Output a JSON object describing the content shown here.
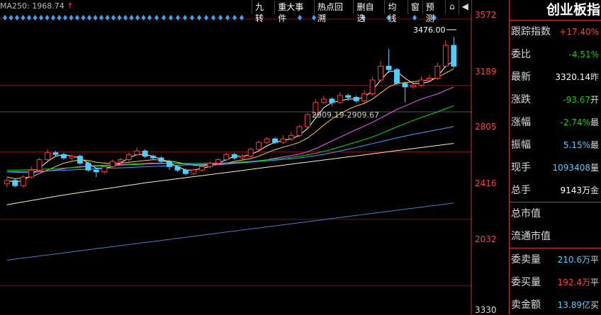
{
  "legend": {
    "ma250_label": "MA250: 1968.74",
    "arrow": "↑"
  },
  "toolbar": {
    "items": [
      "九转",
      "重大事件",
      "热点回溯",
      "删自选",
      "均线",
      "窗",
      "预测"
    ],
    "lock_icon": "lock-icon",
    "back_icon": "back-arrow-icon"
  },
  "price_axis": {
    "labels": [
      "3572",
      "3189",
      "2805",
      "2416",
      "2032",
      "3330"
    ]
  },
  "annotations": {
    "peak_label": "3476.00",
    "level_label": "2909.19-2909.67"
  },
  "panel": {
    "title": "创业板指",
    "rows": [
      {
        "label": "跟踪指数",
        "value": "+17.40%",
        "color": "red",
        "suffix": ""
      },
      {
        "label": "委比",
        "value": "-4.51%",
        "color": "green",
        "suffix": ""
      },
      {
        "label": "最新",
        "value": "3320.14",
        "color": "white",
        "suffix": "昨"
      },
      {
        "label": "涨跌",
        "value": "-93.67",
        "color": "green",
        "suffix": "开"
      },
      {
        "label": "涨幅",
        "value": "-2.74%",
        "color": "green",
        "suffix": "最"
      },
      {
        "label": "振幅",
        "value": "5.15%",
        "color": "cyan",
        "suffix": "最"
      },
      {
        "label": "现手",
        "value": "1093408",
        "color": "cyan",
        "suffix": "量"
      },
      {
        "label": "总手",
        "value": "9143万",
        "color": "white",
        "suffix": "金"
      },
      {
        "label": "总市值",
        "value": "",
        "color": "white",
        "suffix": ""
      },
      {
        "label": "流通市值",
        "value": "",
        "color": "white",
        "suffix": ""
      },
      {
        "label": "委卖量",
        "value": "210.6万",
        "color": "cyan",
        "suffix": "平"
      },
      {
        "label": "委买量",
        "value": "192.4万",
        "color": "red",
        "suffix": "平"
      },
      {
        "label": "卖金额",
        "value": "13.89亿",
        "color": "cyan",
        "suffix": "买"
      }
    ]
  },
  "chart_data": {
    "type": "candlestick",
    "y_ticks": [
      3572,
      3189,
      2805,
      2416,
      2032
    ],
    "ylim": [
      1900,
      3600
    ],
    "candles": [
      [
        2620,
        2640,
        2600,
        2655
      ],
      [
        2640,
        2610,
        2600,
        2650
      ],
      [
        2610,
        2660,
        2600,
        2670
      ],
      [
        2660,
        2700,
        2650,
        2720
      ],
      [
        2700,
        2760,
        2690,
        2770
      ],
      [
        2760,
        2800,
        2740,
        2820
      ],
      [
        2800,
        2790,
        2780,
        2810
      ],
      [
        2790,
        2770,
        2760,
        2800
      ],
      [
        2770,
        2780,
        2750,
        2790
      ],
      [
        2780,
        2740,
        2730,
        2790
      ],
      [
        2740,
        2700,
        2690,
        2750
      ],
      [
        2700,
        2690,
        2660,
        2710
      ],
      [
        2690,
        2720,
        2680,
        2730
      ],
      [
        2720,
        2750,
        2710,
        2760
      ],
      [
        2750,
        2760,
        2730,
        2770
      ],
      [
        2760,
        2790,
        2750,
        2800
      ],
      [
        2790,
        2810,
        2780,
        2830
      ],
      [
        2810,
        2780,
        2770,
        2820
      ],
      [
        2780,
        2770,
        2760,
        2790
      ],
      [
        2770,
        2750,
        2740,
        2780
      ],
      [
        2750,
        2720,
        2700,
        2760
      ],
      [
        2720,
        2700,
        2690,
        2730
      ],
      [
        2700,
        2680,
        2670,
        2710
      ],
      [
        2680,
        2700,
        2670,
        2710
      ],
      [
        2700,
        2720,
        2690,
        2730
      ],
      [
        2720,
        2740,
        2710,
        2750
      ],
      [
        2740,
        2760,
        2730,
        2770
      ],
      [
        2760,
        2790,
        2750,
        2800
      ],
      [
        2790,
        2770,
        2760,
        2800
      ],
      [
        2770,
        2780,
        2760,
        2790
      ],
      [
        2780,
        2820,
        2770,
        2830
      ],
      [
        2820,
        2860,
        2810,
        2870
      ],
      [
        2860,
        2880,
        2850,
        2890
      ],
      [
        2880,
        2860,
        2850,
        2890
      ],
      [
        2860,
        2880,
        2850,
        2900
      ],
      [
        2880,
        2900,
        2870,
        2920
      ],
      [
        2900,
        2950,
        2890,
        2960
      ],
      [
        2950,
        3020,
        2940,
        3030
      ],
      [
        3020,
        3090,
        3010,
        3110
      ],
      [
        3090,
        3110,
        3080,
        3130
      ],
      [
        3110,
        3090,
        3070,
        3120
      ],
      [
        3090,
        3130,
        3080,
        3150
      ],
      [
        3130,
        3120,
        3100,
        3140
      ],
      [
        3120,
        3100,
        3090,
        3130
      ],
      [
        3100,
        3140,
        3090,
        3160
      ],
      [
        3140,
        3220,
        3130,
        3240
      ],
      [
        3220,
        3300,
        3210,
        3330
      ],
      [
        3300,
        3280,
        3260,
        3400
      ],
      [
        3280,
        3200,
        3190,
        3290
      ],
      [
        3200,
        3180,
        3090,
        3210
      ],
      [
        3180,
        3190,
        3170,
        3200
      ],
      [
        3190,
        3220,
        3180,
        3240
      ],
      [
        3220,
        3230,
        3210,
        3250
      ],
      [
        3230,
        3300,
        3220,
        3320
      ],
      [
        3300,
        3420,
        3290,
        3450
      ],
      [
        3420,
        3300,
        3290,
        3470
      ]
    ],
    "ma_lines": [
      {
        "color": "#ffffff",
        "values": [
          2640,
          2630,
          2640,
          2670,
          2710,
          2750,
          2780,
          2790,
          2780,
          2770,
          2740,
          2710,
          2710,
          2720,
          2740,
          2770,
          2790,
          2790,
          2780,
          2760,
          2740,
          2720,
          2700,
          2700,
          2710,
          2720,
          2740,
          2760,
          2780,
          2780,
          2790,
          2810,
          2840,
          2860,
          2870,
          2880,
          2900,
          2940,
          3000,
          3060,
          3090,
          3100,
          3110,
          3110,
          3120,
          3160,
          3220,
          3270,
          3270,
          3230,
          3200,
          3200,
          3210,
          3240,
          3300,
          3330
        ]
      },
      {
        "color": "#ffd21e",
        "values": [
          2660,
          2650,
          2655,
          2660,
          2680,
          2700,
          2720,
          2740,
          2750,
          2760,
          2755,
          2745,
          2740,
          2738,
          2740,
          2745,
          2750,
          2755,
          2760,
          2758,
          2752,
          2745,
          2735,
          2728,
          2725,
          2727,
          2732,
          2740,
          2750,
          2758,
          2766,
          2780,
          2800,
          2818,
          2832,
          2845,
          2860,
          2885,
          2920,
          2960,
          2995,
          3025,
          3050,
          3070,
          3085,
          3110,
          3145,
          3180,
          3200,
          3205,
          3210,
          3215,
          3220,
          3235,
          3260,
          3285
        ]
      },
      {
        "color": "#ff50ff",
        "values": [
          2690,
          2688,
          2686,
          2686,
          2690,
          2695,
          2700,
          2708,
          2714,
          2720,
          2724,
          2726,
          2728,
          2730,
          2732,
          2734,
          2736,
          2738,
          2740,
          2740,
          2739,
          2737,
          2735,
          2732,
          2730,
          2730,
          2731,
          2734,
          2738,
          2742,
          2746,
          2752,
          2760,
          2768,
          2776,
          2784,
          2792,
          2806,
          2824,
          2846,
          2868,
          2890,
          2912,
          2934,
          2954,
          2976,
          3000,
          3026,
          3050,
          3070,
          3090,
          3110,
          3125,
          3140,
          3160,
          3180
        ]
      },
      {
        "color": "#00e000",
        "values": [
          2700,
          2700,
          2701,
          2702,
          2704,
          2706,
          2708,
          2711,
          2714,
          2717,
          2720,
          2722,
          2724,
          2726,
          2728,
          2730,
          2732,
          2734,
          2736,
          2737,
          2738,
          2738,
          2738,
          2738,
          2738,
          2739,
          2740,
          2742,
          2744,
          2747,
          2750,
          2754,
          2758,
          2763,
          2768,
          2774,
          2780,
          2788,
          2797,
          2808,
          2820,
          2834,
          2848,
          2862,
          2876,
          2892,
          2910,
          2930,
          2950,
          2968,
          2986,
          3004,
          3020,
          3036,
          3054,
          3072
        ]
      },
      {
        "color": "#2fa8ff",
        "values": [
          2690,
          2691,
          2692,
          2693,
          2694,
          2695,
          2697,
          2699,
          2701,
          2703,
          2705,
          2707,
          2709,
          2711,
          2713,
          2715,
          2717,
          2719,
          2721,
          2723,
          2725,
          2727,
          2729,
          2731,
          2733,
          2735,
          2737,
          2739,
          2741,
          2744,
          2747,
          2750,
          2753,
          2757,
          2761,
          2765,
          2770,
          2776,
          2783,
          2791,
          2800,
          2810,
          2820,
          2831,
          2842,
          2853,
          2864,
          2875,
          2886,
          2896,
          2906,
          2915,
          2924,
          2933,
          2942,
          2952
        ]
      },
      {
        "color": "#fff0b0",
        "values": [
          2500,
          2508,
          2516,
          2524,
          2532,
          2540,
          2548,
          2556,
          2563,
          2570,
          2577,
          2584,
          2591,
          2598,
          2605,
          2612,
          2619,
          2626,
          2632,
          2638,
          2644,
          2650,
          2656,
          2662,
          2668,
          2674,
          2680,
          2686,
          2692,
          2698,
          2704,
          2710,
          2716,
          2722,
          2728,
          2734,
          2740,
          2746,
          2752,
          2758,
          2764,
          2770,
          2776,
          2782,
          2788,
          2794,
          2800,
          2806,
          2812,
          2818,
          2824,
          2830,
          2836,
          2842,
          2848,
          2854
        ]
      },
      {
        "color": "#3f7fbf",
        "values": [
          2180,
          2186,
          2192,
          2198,
          2204,
          2210,
          2216,
          2222,
          2228,
          2234,
          2240,
          2246,
          2252,
          2258,
          2264,
          2270,
          2276,
          2282,
          2288,
          2294,
          2300,
          2306,
          2312,
          2318,
          2324,
          2330,
          2336,
          2342,
          2348,
          2354,
          2360,
          2366,
          2372,
          2378,
          2384,
          2390,
          2396,
          2402,
          2408,
          2414,
          2420,
          2426,
          2432,
          2438,
          2444,
          2450,
          2456,
          2462,
          2468,
          2474,
          2480,
          2486,
          2492,
          2498,
          2504,
          2510
        ]
      }
    ],
    "colors": {
      "up": "#ff3b3b",
      "down": "#4cd0ff",
      "grid": "#7a1010",
      "marker": "#2fa8ff"
    }
  }
}
